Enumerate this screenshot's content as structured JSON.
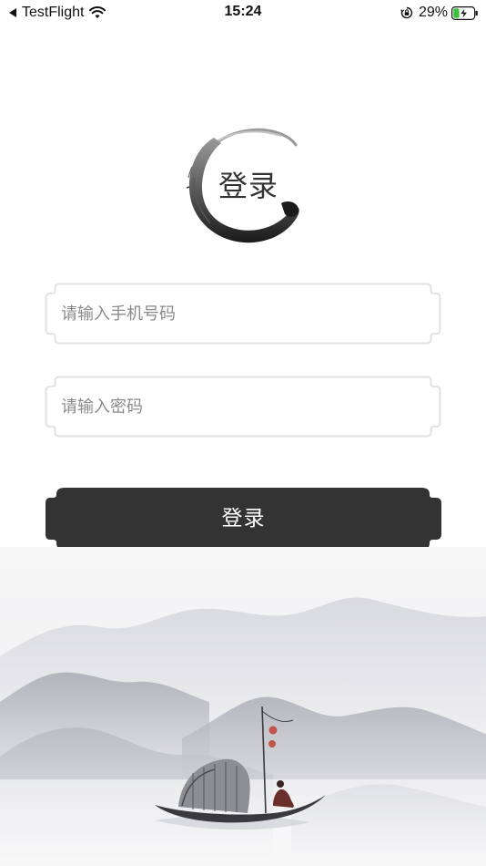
{
  "status_bar": {
    "back_app": "TestFlight",
    "time": "15:24",
    "battery_percent": "29%",
    "battery_level": 0.29
  },
  "logo": {
    "text": "登录"
  },
  "form": {
    "phone_placeholder": "请输入手机号码",
    "phone_value": "",
    "password_placeholder": "请输入密码",
    "password_value": ""
  },
  "login_button": {
    "label": "登录"
  },
  "colors": {
    "button_bg": "#333333",
    "field_border": "#e2e2e2",
    "battery_green": "#3cc13b"
  },
  "icons": {
    "back": "back-arrow-icon",
    "wifi": "wifi-icon",
    "orientation_lock": "orientation-lock-icon",
    "battery": "battery-charging-icon"
  }
}
